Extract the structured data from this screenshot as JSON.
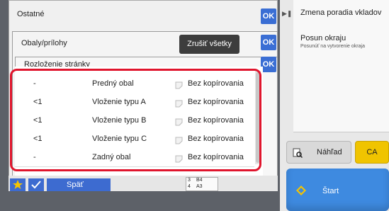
{
  "right_panel": {
    "items": [
      {
        "title": "Zmena poradia vkladov",
        "subtitle": ""
      },
      {
        "title": "Posun okraju",
        "subtitle": "Posunúť na vytvorenie okraja"
      }
    ],
    "preview_label": "Náhľad",
    "ca_label": "CA",
    "start_label": "Štart"
  },
  "dialogs": {
    "outer": {
      "title": "Ostatné",
      "ok_label": "OK"
    },
    "covers": {
      "title": "Obaly/prílohy",
      "cancel_all_label": "Zrušiť všetky",
      "ok_label": "OK"
    },
    "layout": {
      "title": "Rozloženie stránky",
      "ok_label": "OK"
    }
  },
  "table": {
    "rows": [
      {
        "pos": "-",
        "name": "Predný obal",
        "mode": "Bez kopírovania"
      },
      {
        "pos": "<1",
        "name": "Vloženie typu A",
        "mode": "Bez kopírovania"
      },
      {
        "pos": "<1",
        "name": "Vloženie typu B",
        "mode": "Bez kopírovania"
      },
      {
        "pos": "<1",
        "name": "Vloženie typu C",
        "mode": "Bez kopírovania"
      },
      {
        "pos": "-",
        "name": "Zadný obal",
        "mode": "Bez kopírovania"
      }
    ]
  },
  "bottom": {
    "back_label": "Späť",
    "paper": {
      "tray3": "B4",
      "tray4": "A3",
      "tray3_num": "3",
      "tray4_num": "4"
    }
  },
  "colors": {
    "highlight": "#e0152d",
    "ok_blue": "#3a6ed4",
    "start_blue": "#3e8ae0",
    "ca_yellow": "#f0c400"
  }
}
